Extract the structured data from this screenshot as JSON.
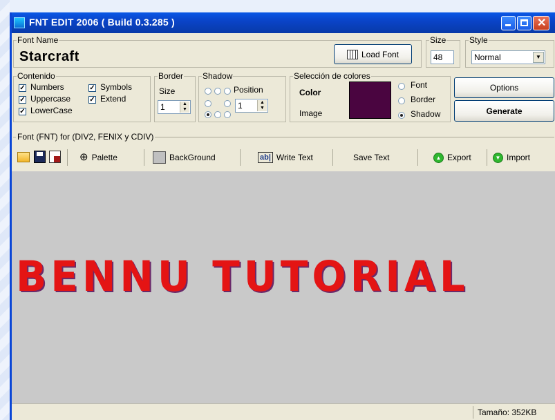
{
  "window": {
    "title": "FNT EDIT 2006 ( Build 0.3.285 )"
  },
  "font_name": {
    "label": "Font Name",
    "value": "Starcraft",
    "load_label": "Load Font"
  },
  "size": {
    "label": "Size",
    "value": "48"
  },
  "style": {
    "label": "Style",
    "value": "Normal"
  },
  "contenido": {
    "label": "Contenido",
    "items": [
      {
        "label": "Numbers",
        "checked": true
      },
      {
        "label": "Symbols",
        "checked": true
      },
      {
        "label": "Uppercase",
        "checked": true
      },
      {
        "label": "Extend",
        "checked": true
      },
      {
        "label": "LowerCase",
        "checked": true
      }
    ]
  },
  "border": {
    "label": "Border",
    "size_label": "Size",
    "value": "1"
  },
  "shadow": {
    "label": "Shadow",
    "position_label": "Position",
    "value": "1"
  },
  "colores": {
    "label": "Selección de colores",
    "color_label": "Color",
    "image_label": "Image",
    "swatch": "#4a0540",
    "options": [
      {
        "label": "Font",
        "selected": false
      },
      {
        "label": "Border",
        "selected": false
      },
      {
        "label": "Shadow",
        "selected": true
      }
    ]
  },
  "actions": {
    "options": "Options",
    "generate": "Generate"
  },
  "panel": {
    "label": "Font (FNT) for (DIV2, FENIX y CDIV)"
  },
  "toolbar": {
    "palette": "Palette",
    "background": "BackGround",
    "write_text": "Write Text",
    "save_text": "Save Text",
    "export": "Export",
    "import": "Import"
  },
  "canvas": {
    "text": "BENNU TUTORIAL"
  },
  "status": {
    "size": "Tamaño: 352KB"
  }
}
